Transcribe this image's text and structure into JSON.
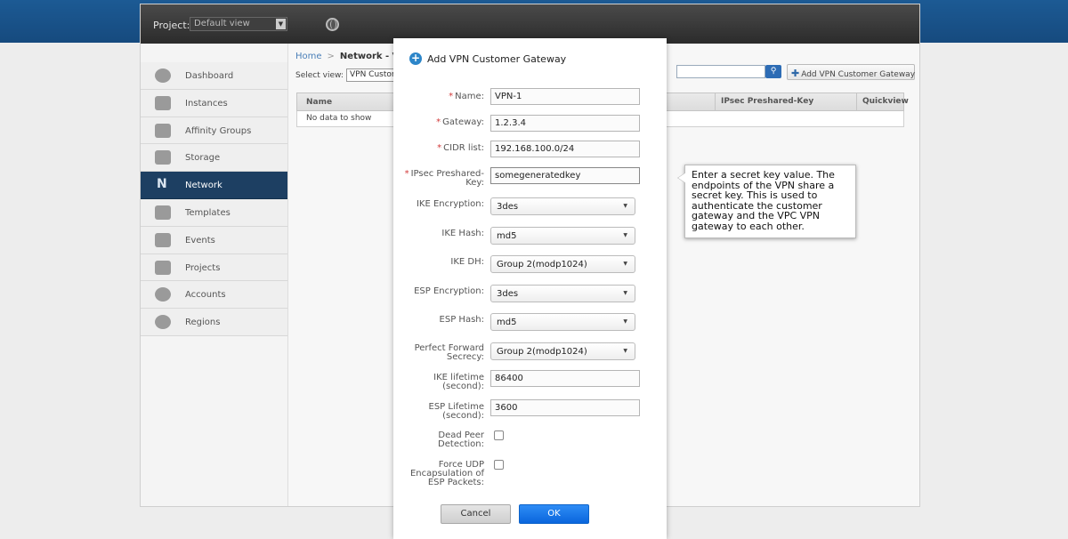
{
  "header": {
    "project_label": "Project:",
    "project_value": "Default view"
  },
  "sidebar": {
    "items": [
      {
        "label": "Dashboard",
        "icon": "dashboard-icon"
      },
      {
        "label": "Instances",
        "icon": "cloud-icon"
      },
      {
        "label": "Affinity Groups",
        "icon": "affinity-groups-icon"
      },
      {
        "label": "Storage",
        "icon": "storage-icon"
      },
      {
        "label": "Network",
        "icon": "network-icon",
        "active": true
      },
      {
        "label": "Templates",
        "icon": "templates-icon"
      },
      {
        "label": "Events",
        "icon": "calendar-icon"
      },
      {
        "label": "Projects",
        "icon": "folder-icon"
      },
      {
        "label": "Accounts",
        "icon": "user-icon"
      },
      {
        "label": "Regions",
        "icon": "globe-icon"
      }
    ]
  },
  "main": {
    "breadcrumb": {
      "home": "Home",
      "sep": ">",
      "current": "Network - VPN"
    },
    "select_view_label": "Select view:",
    "select_view_value": "VPN Customer Gateway",
    "add_button_label": "Add VPN Customer Gateway",
    "grid": {
      "columns": [
        "Name",
        "IPsec Preshared-Key",
        "Quickview"
      ],
      "empty_text": "No data to show"
    }
  },
  "dialog": {
    "title": "Add VPN Customer Gateway",
    "required_mark": "*",
    "fields": {
      "name": {
        "label": "Name:",
        "value": "VPN-1"
      },
      "gateway": {
        "label": "Gateway:",
        "value": "1.2.3.4"
      },
      "cidr": {
        "label": "CIDR list:",
        "value": "192.168.100.0/24"
      },
      "ipsec_psk": {
        "label_1": "IPsec Preshared-",
        "label_2": "Key:",
        "value": "somegeneratedkey"
      },
      "ike_encryption": {
        "label": "IKE Encryption:",
        "value": "3des"
      },
      "ike_hash": {
        "label": "IKE Hash:",
        "value": "md5"
      },
      "ike_dh": {
        "label": "IKE DH:",
        "value": "Group 2(modp1024)"
      },
      "esp_encryption": {
        "label": "ESP Encryption:",
        "value": "3des"
      },
      "esp_hash": {
        "label": "ESP Hash:",
        "value": "md5"
      },
      "pfs": {
        "label_1": "Perfect Forward",
        "label_2": "Secrecy:",
        "value": "Group 2(modp1024)"
      },
      "ike_lifetime": {
        "label_1": "IKE lifetime",
        "label_2": "(second):",
        "value": "86400"
      },
      "esp_lifetime": {
        "label_1": "ESP Lifetime",
        "label_2": "(second):",
        "value": "3600"
      },
      "dpd": {
        "label_1": "Dead Peer",
        "label_2": "Detection:"
      },
      "force_udp": {
        "label_1": "Force UDP",
        "label_2": "Encapsulation of",
        "label_3": "ESP Packets:"
      }
    },
    "cancel_label": "Cancel",
    "ok_label": "OK"
  },
  "tooltip": {
    "lines": [
      "Enter a secret key value. The",
      "endpoints of the VPN share a",
      "secret key. This is used to",
      "authenticate the customer",
      "gateway and the VPC VPN",
      "gateway to each other."
    ]
  }
}
